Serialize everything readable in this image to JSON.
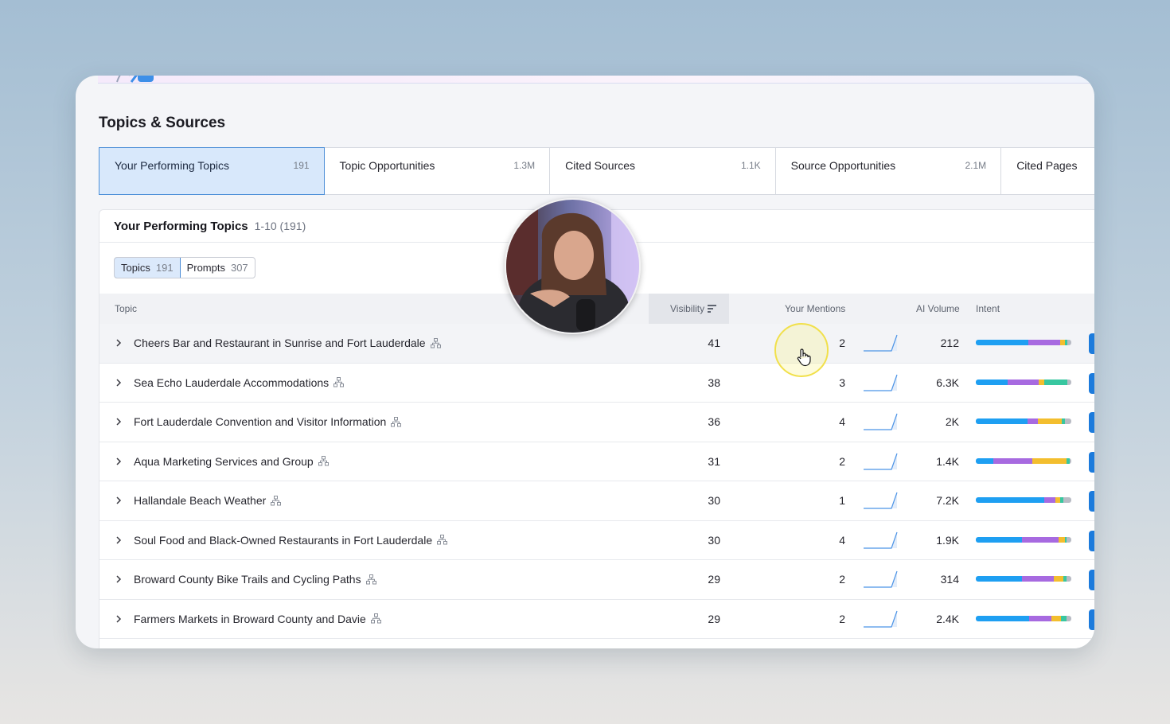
{
  "section_title": "Topics & Sources",
  "tabs": [
    {
      "label": "Your Performing Topics",
      "count": "191",
      "active": true
    },
    {
      "label": "Topic Opportunities",
      "count": "1.3M"
    },
    {
      "label": "Cited Sources",
      "count": "1.1K"
    },
    {
      "label": "Source Opportunities",
      "count": "2.1M"
    },
    {
      "label": "Cited Pages",
      "count": ""
    }
  ],
  "panel": {
    "title": "Your Performing Topics",
    "range": "1-10 (191)",
    "toggles": [
      {
        "label": "Topics",
        "count": "191",
        "active": true
      },
      {
        "label": "Prompts",
        "count": "307"
      }
    ]
  },
  "columns": {
    "topic": "Topic",
    "visibility": "Visibility",
    "mentions": "Your Mentions",
    "ai_volume": "AI Volume",
    "intent": "Intent"
  },
  "intent_colors": {
    "informational": "#1e9ff2",
    "navigational": "#a76ae0",
    "commercial": "#f3be2e",
    "transactional": "#38c7a0",
    "other": "#b9bcc5"
  },
  "rows": [
    {
      "topic": "Cheers Bar and Restaurant in Sunrise and Fort Lauderdale",
      "visibility": "41",
      "mentions": "2",
      "ai_volume": "212",
      "intent": [
        55,
        33,
        5,
        3,
        4
      ]
    },
    {
      "topic": "Sea Echo Lauderdale Accommodations",
      "visibility": "38",
      "mentions": "3",
      "ai_volume": "6.3K",
      "intent": [
        33,
        33,
        6,
        24,
        4
      ]
    },
    {
      "topic": "Fort Lauderdale Convention and Visitor Information",
      "visibility": "36",
      "mentions": "4",
      "ai_volume": "2K",
      "intent": [
        54,
        11,
        25,
        3,
        7
      ]
    },
    {
      "topic": "Aqua Marketing Services and Group",
      "visibility": "31",
      "mentions": "2",
      "ai_volume": "1.4K",
      "intent": [
        18,
        41,
        36,
        3,
        2
      ]
    },
    {
      "topic": "Hallandale Beach Weather",
      "visibility": "30",
      "mentions": "1",
      "ai_volume": "7.2K",
      "intent": [
        72,
        11,
        5,
        4,
        8
      ]
    },
    {
      "topic": "Soul Food and Black-Owned Restaurants in Fort Lauderdale",
      "visibility": "30",
      "mentions": "4",
      "ai_volume": "1.9K",
      "intent": [
        48,
        39,
        6,
        2,
        5
      ]
    },
    {
      "topic": "Broward County Bike Trails and Cycling Paths",
      "visibility": "29",
      "mentions": "2",
      "ai_volume": "314",
      "intent": [
        48,
        34,
        10,
        3,
        5
      ]
    },
    {
      "topic": "Farmers Markets in Broward County and Davie",
      "visibility": "29",
      "mentions": "2",
      "ai_volume": "2.4K",
      "intent": [
        56,
        23,
        10,
        6,
        5
      ]
    }
  ]
}
